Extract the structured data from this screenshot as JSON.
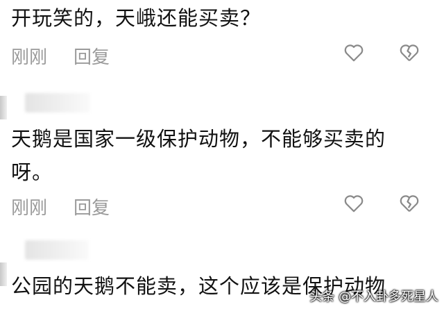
{
  "comments": [
    {
      "text": "开玩笑的，天峨还能买卖？",
      "time": "刚刚",
      "reply": "回复"
    },
    {
      "text": "天鹅是国家一级保护动物，不能够买卖的呀。",
      "time": "刚刚",
      "reply": "回复"
    },
    {
      "text": "公园的天鹅不能卖，这个应该是保护动物"
    }
  ],
  "icons": {
    "like": "heart-outline-icon",
    "dislike": "broken-heart-icon"
  },
  "watermark": "头条 @不入卦多死星人",
  "colors": {
    "text": "#111111",
    "meta": "#9a9a9a",
    "icon": "#8a8a8a"
  }
}
